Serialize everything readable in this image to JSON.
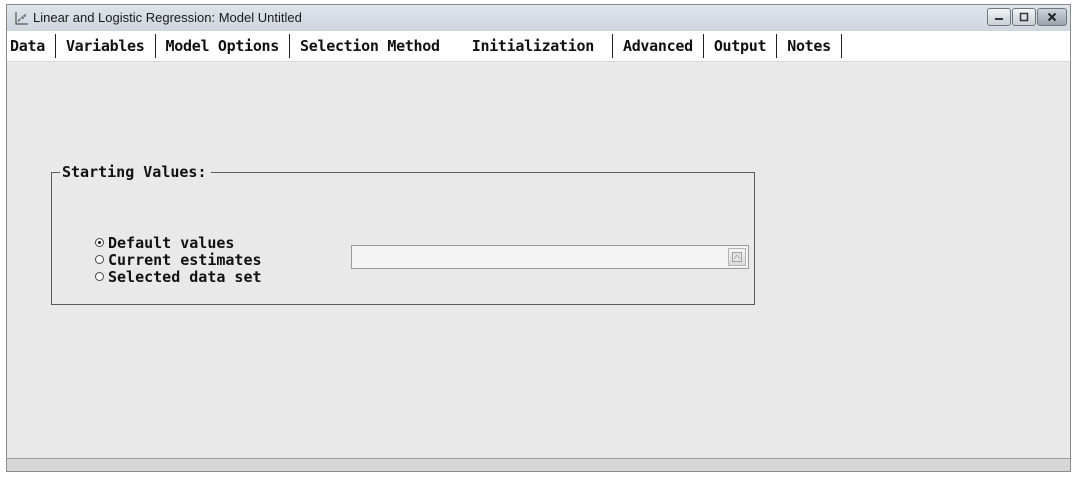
{
  "window": {
    "title": "Linear and Logistic Regression: Model Untitled",
    "controls": {
      "minimize_icon": "minimize-icon",
      "maximize_icon": "maximize-icon",
      "close_icon": "close-icon"
    }
  },
  "tabs": [
    {
      "label": "Data",
      "active": false
    },
    {
      "label": "Variables",
      "active": false
    },
    {
      "label": "Model Options",
      "active": false
    },
    {
      "label": "Selection Method",
      "active": false
    },
    {
      "label": "Initialization",
      "active": true
    },
    {
      "label": "Advanced",
      "active": false
    },
    {
      "label": "Output",
      "active": false
    },
    {
      "label": "Notes",
      "active": false
    }
  ],
  "starting_values": {
    "legend": "Starting Values:",
    "options": [
      {
        "label": "Default values",
        "checked": true
      },
      {
        "label": "Current estimates",
        "checked": false
      },
      {
        "label": "Selected data set",
        "checked": false
      }
    ],
    "dataset_select": {
      "value": "",
      "enabled": false
    }
  },
  "colors": {
    "panel_bg": "#e9e9e9",
    "tab_bar_bg": "#ffffff",
    "text": "#111111"
  }
}
